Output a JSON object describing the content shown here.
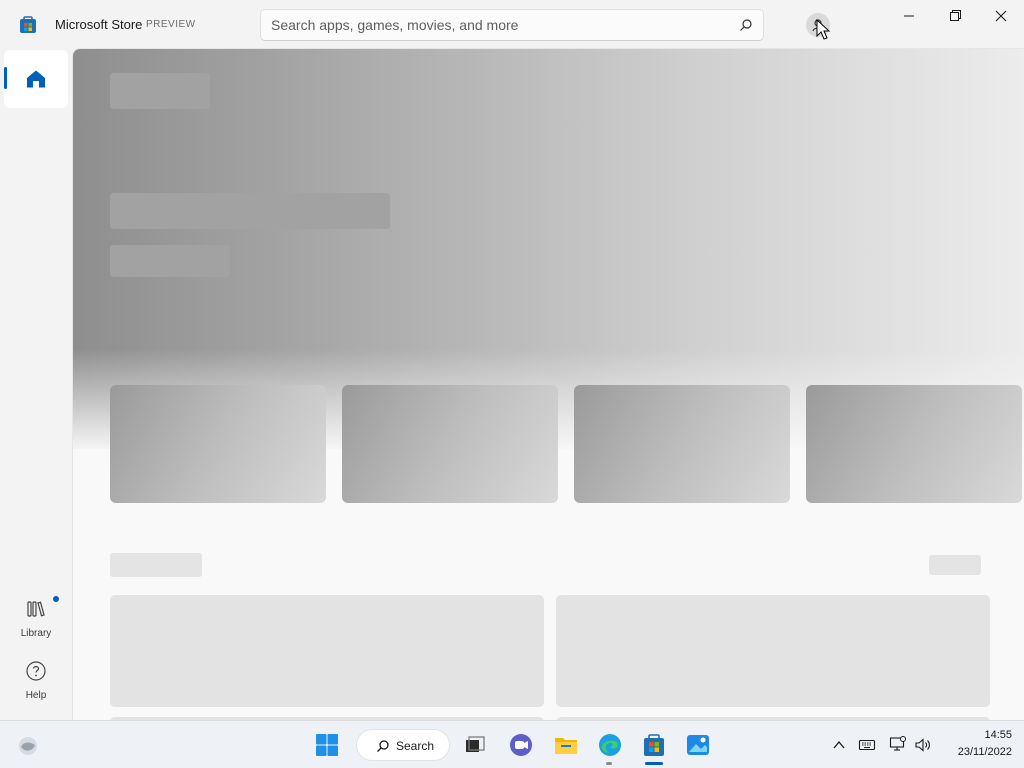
{
  "window": {
    "title": "Microsoft Store",
    "badge": "PREVIEW",
    "controls": {
      "minimize_icon": "minimize-icon",
      "maximize_icon": "restore-icon",
      "close_icon": "close-icon"
    }
  },
  "search": {
    "placeholder": "Search apps, games, movies, and more",
    "value": "",
    "icon": "search-icon"
  },
  "account": {
    "icon": "account-icon"
  },
  "sidebar": {
    "items": [
      {
        "label": "",
        "icon": "home-icon",
        "selected": true
      },
      {
        "label": "Library",
        "icon": "library-icon",
        "has_badge": true
      },
      {
        "label": "Help",
        "icon": "help-icon"
      }
    ]
  },
  "colors": {
    "accent": "#005fb8",
    "placeholder": "#a2a2a2"
  },
  "taskbar": {
    "search_label": "Search",
    "apps": [
      "start-icon",
      "taskview-icon",
      "chat-icon",
      "file-explorer-icon",
      "edge-icon",
      "store-icon",
      "photos-icon"
    ],
    "tray": [
      "chevron-up-icon",
      "keyboard-icon",
      "network-icon",
      "volume-icon"
    ],
    "time": "14:55",
    "date": "23/11/2022"
  }
}
